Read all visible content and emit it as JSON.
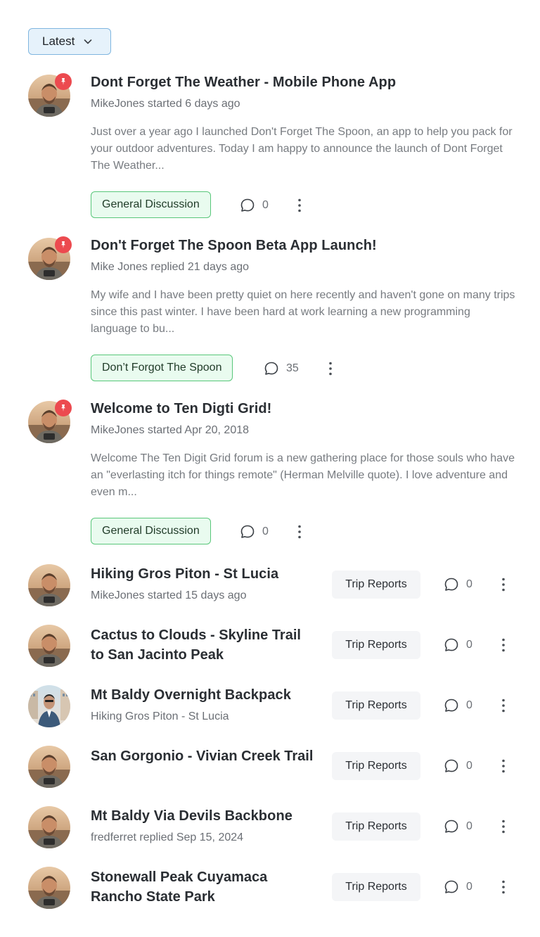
{
  "sort": {
    "label": "Latest"
  },
  "featured": [
    {
      "title": "Dont Forget The Weather - Mobile Phone App",
      "meta": "MikeJones started 6 days ago",
      "excerpt": "Just over a year ago I launched Don't Forget The Spoon, an app to help you pack for your outdoor adventures. Today I am happy to announce the launch of Dont Forget The Weather...",
      "category": "General Discussion",
      "comments": "0",
      "pinned": true
    },
    {
      "title": "Don't Forget The Spoon Beta App Launch!",
      "meta": "Mike Jones replied 21 days ago",
      "excerpt": "My wife and I have been pretty quiet on here recently and haven't gone on many trips since this past winter. I have been hard at work learning a new programming language to bu...",
      "category": "Don’t Forgot The Spoon",
      "comments": "35",
      "pinned": true
    },
    {
      "title": "Welcome to Ten Digti Grid!",
      "meta": "MikeJones started Apr 20, 2018",
      "excerpt": "Welcome The Ten Digit Grid forum is a new gathering place for those souls who have an \"everlasting itch for things remote\" (Herman Melville quote). I love adventure and even m...",
      "category": "General Discussion",
      "comments": "0",
      "pinned": true
    }
  ],
  "topics": [
    {
      "title": "Hiking Gros Piton - St Lucia",
      "meta": "MikeJones started 15 days ago",
      "category": "Trip Reports",
      "comments": "0"
    },
    {
      "title": "Cactus to Clouds - Skyline Trail to San Jacinto Peak",
      "meta": "",
      "category": "Trip Reports",
      "comments": "0"
    },
    {
      "title": "Mt Baldy Overnight Backpack",
      "meta": "Hiking Gros Piton - St Lucia",
      "category": "Trip Reports",
      "comments": "0"
    },
    {
      "title": "San Gorgonio - Vivian Creek Trail",
      "meta": "",
      "category": "Trip Reports",
      "comments": "0"
    },
    {
      "title": "Mt Baldy Via Devils Backbone",
      "meta": "fredferret replied Sep 15, 2024",
      "category": "Trip Reports",
      "comments": "0"
    },
    {
      "title": "Stonewall Peak Cuyamaca Rancho State Park",
      "meta": "",
      "category": "Trip Reports",
      "comments": "0"
    }
  ],
  "colors": {
    "pin": "#ec4a4f",
    "tag_green_border": "#59c77a",
    "tag_green_bg": "#e9fbef",
    "sort_bg": "#e6f2fb",
    "sort_border": "#7fb6e0"
  },
  "icons": {
    "sort": "chevron-down-icon",
    "pin": "pin-icon",
    "comments": "comment-bubble-icon",
    "more": "more-vertical-icon"
  }
}
